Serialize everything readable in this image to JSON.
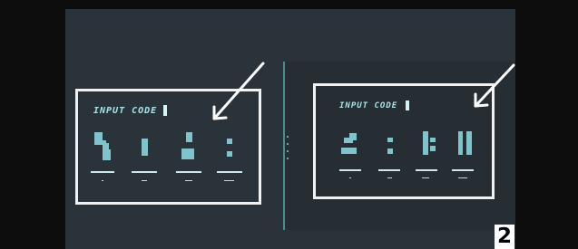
{
  "left_screen": {
    "code_label": "INPUT CODE"
  },
  "right_screen": {
    "code_label": "INPUT CODE"
  },
  "page_number": "2",
  "colors": {
    "background": "#2b333a",
    "frame": "#f2f2f2",
    "glyph": "#7fc4cc",
    "label": "#a8e4e7",
    "divider": "#4d8a94"
  },
  "icons": [
    "arrow-icon"
  ]
}
